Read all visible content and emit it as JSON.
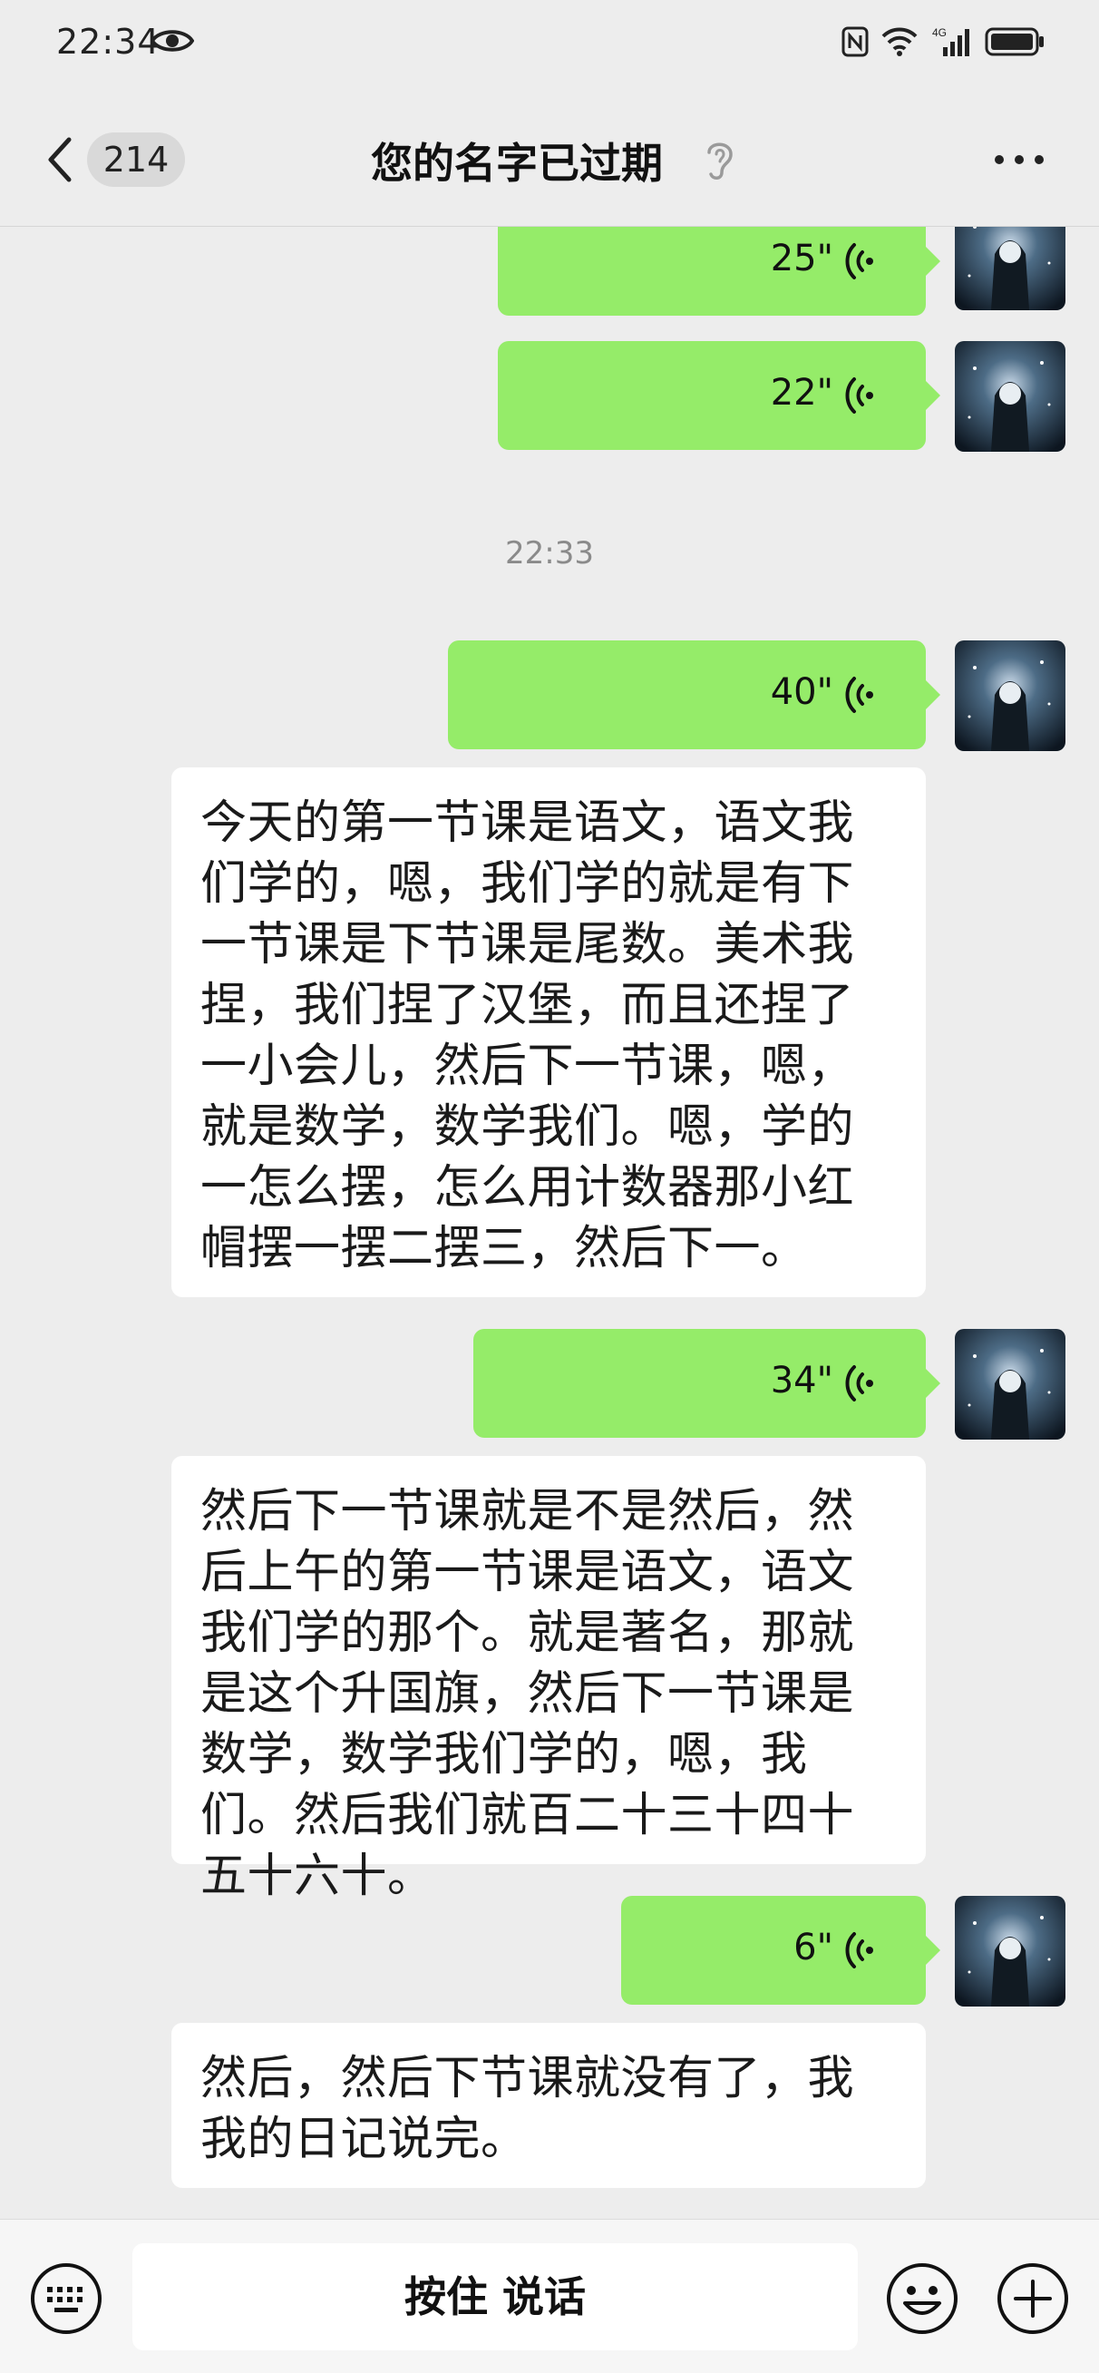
{
  "status_bar": {
    "time": "22:34",
    "network": "4G"
  },
  "header": {
    "badge_count": "214",
    "title": "您的名字已过期"
  },
  "chat": {
    "timestamp": "22:33",
    "voice_messages": [
      {
        "duration": "25\""
      },
      {
        "duration": "22\""
      },
      {
        "duration": "40\""
      },
      {
        "duration": "34\""
      },
      {
        "duration": "6\""
      }
    ],
    "transcripts": [
      "今天的第一节课是语文，语文我们学的，嗯，我们学的就是有下一节课是下节课是尾数。美术我捏，我们捏了汉堡，而且还捏了一小会儿，然后下一节课，嗯，就是数学，数学我们。嗯，学的一怎么摆，怎么用计数器那小红帽摆一摆二摆三，然后下一。",
      "然后下一节课就是不是然后，然后上午的第一节课是语文，语文我们学的那个。就是著名，那就是这个升国旗，然后下一节课是数学，数学我们学的，嗯，我们。然后我们就百二十三十四十五十六十。",
      "然后，然后下节课就没有了，我我的日记说完。"
    ]
  },
  "input_bar": {
    "hold_to_talk_label": "按住 说话"
  },
  "colors": {
    "background": "#ededed",
    "outgoing_bubble": "#95ec69",
    "transcript_bubble": "#ffffff"
  },
  "icons": [
    "eye-icon",
    "nfc-icon",
    "wifi-icon",
    "signal-icon",
    "battery-icon",
    "back-icon",
    "ear-icon",
    "more-icon",
    "voice-wave-icon",
    "keyboard-icon",
    "emoji-icon",
    "plus-icon"
  ]
}
